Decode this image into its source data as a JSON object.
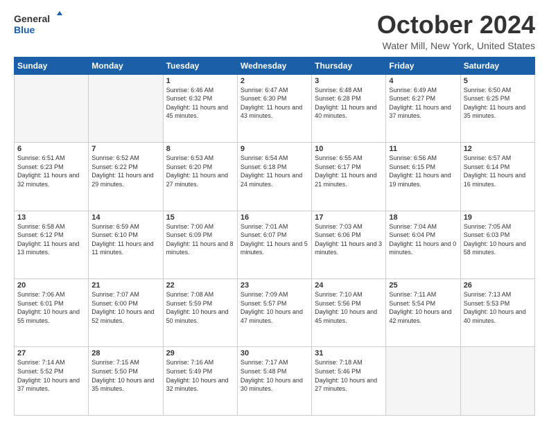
{
  "header": {
    "logo_line1": "General",
    "logo_line2": "Blue",
    "month_title": "October 2024",
    "location": "Water Mill, New York, United States"
  },
  "days_of_week": [
    "Sunday",
    "Monday",
    "Tuesday",
    "Wednesday",
    "Thursday",
    "Friday",
    "Saturday"
  ],
  "weeks": [
    [
      {
        "day": "",
        "sunrise": "",
        "sunset": "",
        "daylight": "",
        "empty": true
      },
      {
        "day": "",
        "sunrise": "",
        "sunset": "",
        "daylight": "",
        "empty": true
      },
      {
        "day": "1",
        "sunrise": "Sunrise: 6:46 AM",
        "sunset": "Sunset: 6:32 PM",
        "daylight": "Daylight: 11 hours and 45 minutes."
      },
      {
        "day": "2",
        "sunrise": "Sunrise: 6:47 AM",
        "sunset": "Sunset: 6:30 PM",
        "daylight": "Daylight: 11 hours and 43 minutes."
      },
      {
        "day": "3",
        "sunrise": "Sunrise: 6:48 AM",
        "sunset": "Sunset: 6:28 PM",
        "daylight": "Daylight: 11 hours and 40 minutes."
      },
      {
        "day": "4",
        "sunrise": "Sunrise: 6:49 AM",
        "sunset": "Sunset: 6:27 PM",
        "daylight": "Daylight: 11 hours and 37 minutes."
      },
      {
        "day": "5",
        "sunrise": "Sunrise: 6:50 AM",
        "sunset": "Sunset: 6:25 PM",
        "daylight": "Daylight: 11 hours and 35 minutes."
      }
    ],
    [
      {
        "day": "6",
        "sunrise": "Sunrise: 6:51 AM",
        "sunset": "Sunset: 6:23 PM",
        "daylight": "Daylight: 11 hours and 32 minutes."
      },
      {
        "day": "7",
        "sunrise": "Sunrise: 6:52 AM",
        "sunset": "Sunset: 6:22 PM",
        "daylight": "Daylight: 11 hours and 29 minutes."
      },
      {
        "day": "8",
        "sunrise": "Sunrise: 6:53 AM",
        "sunset": "Sunset: 6:20 PM",
        "daylight": "Daylight: 11 hours and 27 minutes."
      },
      {
        "day": "9",
        "sunrise": "Sunrise: 6:54 AM",
        "sunset": "Sunset: 6:18 PM",
        "daylight": "Daylight: 11 hours and 24 minutes."
      },
      {
        "day": "10",
        "sunrise": "Sunrise: 6:55 AM",
        "sunset": "Sunset: 6:17 PM",
        "daylight": "Daylight: 11 hours and 21 minutes."
      },
      {
        "day": "11",
        "sunrise": "Sunrise: 6:56 AM",
        "sunset": "Sunset: 6:15 PM",
        "daylight": "Daylight: 11 hours and 19 minutes."
      },
      {
        "day": "12",
        "sunrise": "Sunrise: 6:57 AM",
        "sunset": "Sunset: 6:14 PM",
        "daylight": "Daylight: 11 hours and 16 minutes."
      }
    ],
    [
      {
        "day": "13",
        "sunrise": "Sunrise: 6:58 AM",
        "sunset": "Sunset: 6:12 PM",
        "daylight": "Daylight: 11 hours and 13 minutes."
      },
      {
        "day": "14",
        "sunrise": "Sunrise: 6:59 AM",
        "sunset": "Sunset: 6:10 PM",
        "daylight": "Daylight: 11 hours and 11 minutes."
      },
      {
        "day": "15",
        "sunrise": "Sunrise: 7:00 AM",
        "sunset": "Sunset: 6:09 PM",
        "daylight": "Daylight: 11 hours and 8 minutes."
      },
      {
        "day": "16",
        "sunrise": "Sunrise: 7:01 AM",
        "sunset": "Sunset: 6:07 PM",
        "daylight": "Daylight: 11 hours and 5 minutes."
      },
      {
        "day": "17",
        "sunrise": "Sunrise: 7:03 AM",
        "sunset": "Sunset: 6:06 PM",
        "daylight": "Daylight: 11 hours and 3 minutes."
      },
      {
        "day": "18",
        "sunrise": "Sunrise: 7:04 AM",
        "sunset": "Sunset: 6:04 PM",
        "daylight": "Daylight: 11 hours and 0 minutes."
      },
      {
        "day": "19",
        "sunrise": "Sunrise: 7:05 AM",
        "sunset": "Sunset: 6:03 PM",
        "daylight": "Daylight: 10 hours and 58 minutes."
      }
    ],
    [
      {
        "day": "20",
        "sunrise": "Sunrise: 7:06 AM",
        "sunset": "Sunset: 6:01 PM",
        "daylight": "Daylight: 10 hours and 55 minutes."
      },
      {
        "day": "21",
        "sunrise": "Sunrise: 7:07 AM",
        "sunset": "Sunset: 6:00 PM",
        "daylight": "Daylight: 10 hours and 52 minutes."
      },
      {
        "day": "22",
        "sunrise": "Sunrise: 7:08 AM",
        "sunset": "Sunset: 5:59 PM",
        "daylight": "Daylight: 10 hours and 50 minutes."
      },
      {
        "day": "23",
        "sunrise": "Sunrise: 7:09 AM",
        "sunset": "Sunset: 5:57 PM",
        "daylight": "Daylight: 10 hours and 47 minutes."
      },
      {
        "day": "24",
        "sunrise": "Sunrise: 7:10 AM",
        "sunset": "Sunset: 5:56 PM",
        "daylight": "Daylight: 10 hours and 45 minutes."
      },
      {
        "day": "25",
        "sunrise": "Sunrise: 7:11 AM",
        "sunset": "Sunset: 5:54 PM",
        "daylight": "Daylight: 10 hours and 42 minutes."
      },
      {
        "day": "26",
        "sunrise": "Sunrise: 7:13 AM",
        "sunset": "Sunset: 5:53 PM",
        "daylight": "Daylight: 10 hours and 40 minutes."
      }
    ],
    [
      {
        "day": "27",
        "sunrise": "Sunrise: 7:14 AM",
        "sunset": "Sunset: 5:52 PM",
        "daylight": "Daylight: 10 hours and 37 minutes."
      },
      {
        "day": "28",
        "sunrise": "Sunrise: 7:15 AM",
        "sunset": "Sunset: 5:50 PM",
        "daylight": "Daylight: 10 hours and 35 minutes."
      },
      {
        "day": "29",
        "sunrise": "Sunrise: 7:16 AM",
        "sunset": "Sunset: 5:49 PM",
        "daylight": "Daylight: 10 hours and 32 minutes."
      },
      {
        "day": "30",
        "sunrise": "Sunrise: 7:17 AM",
        "sunset": "Sunset: 5:48 PM",
        "daylight": "Daylight: 10 hours and 30 minutes."
      },
      {
        "day": "31",
        "sunrise": "Sunrise: 7:18 AM",
        "sunset": "Sunset: 5:46 PM",
        "daylight": "Daylight: 10 hours and 27 minutes."
      },
      {
        "day": "",
        "sunrise": "",
        "sunset": "",
        "daylight": "",
        "empty": true
      },
      {
        "day": "",
        "sunrise": "",
        "sunset": "",
        "daylight": "",
        "empty": true
      }
    ]
  ]
}
